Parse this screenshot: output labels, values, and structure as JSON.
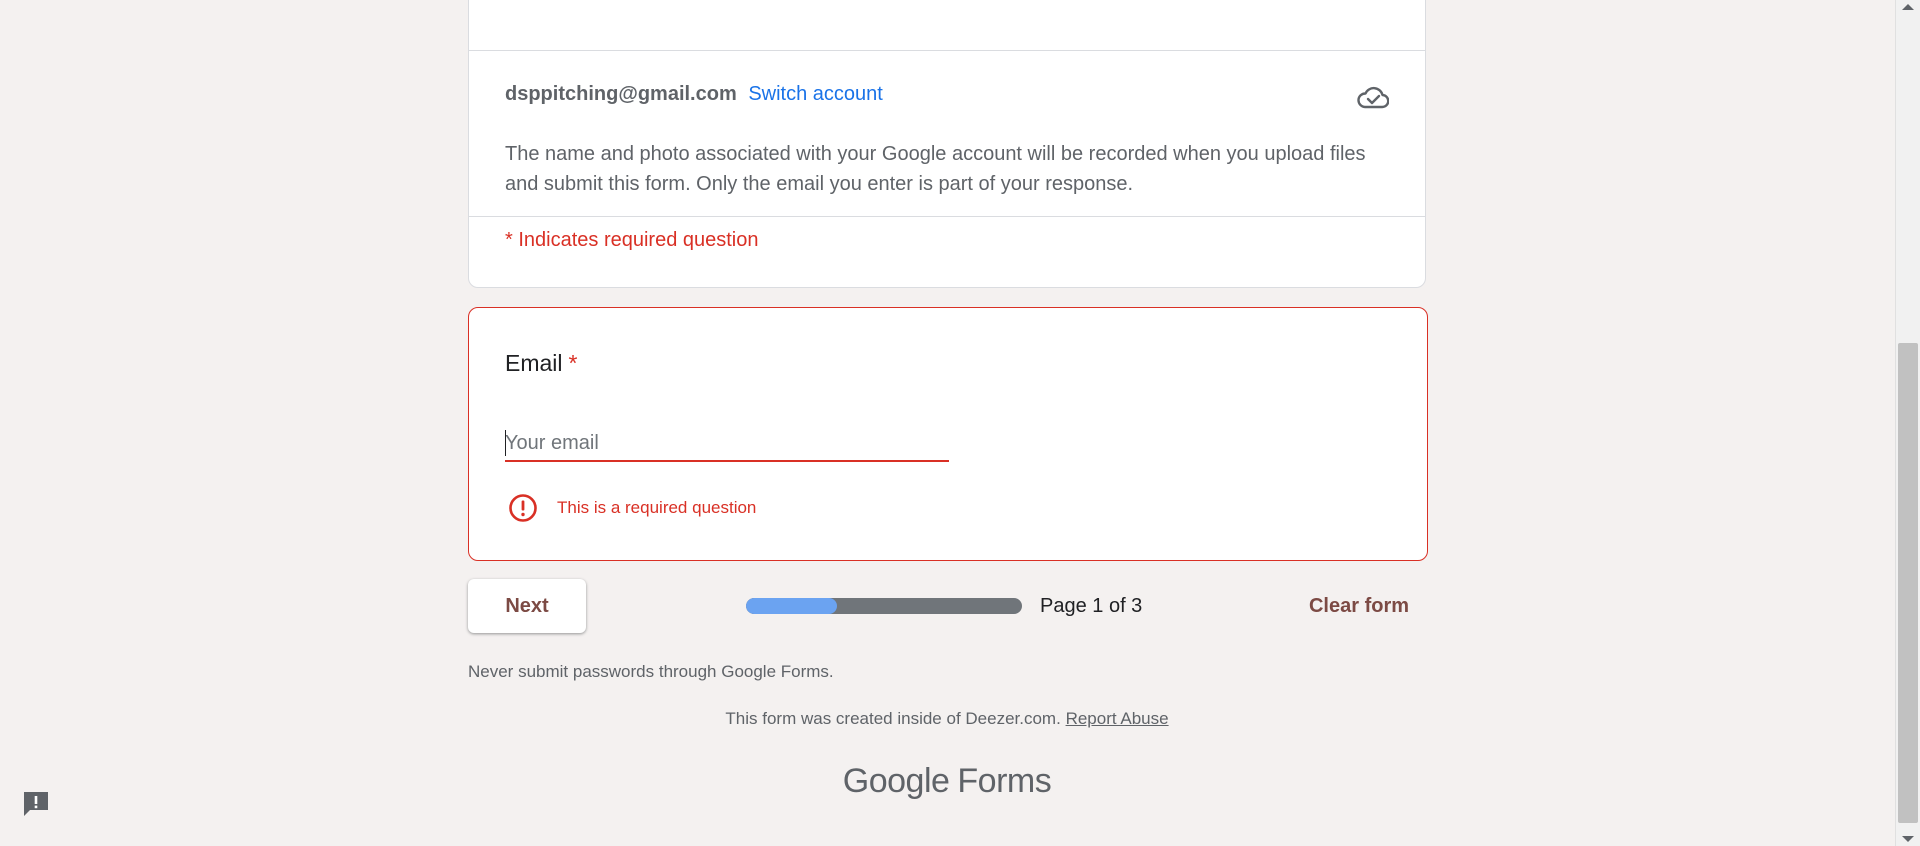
{
  "account": {
    "email": "dsppitching@gmail.com",
    "switch_label": "Switch account",
    "note": "The name and photo associated with your Google account will be recorded when you upload files and submit this form. Only the email you enter is part of your response.",
    "saved_icon": "cloud-check-icon"
  },
  "form": {
    "required_note": "* Indicates required question"
  },
  "question": {
    "title": "Email",
    "required_mark": "*",
    "placeholder": "Your email",
    "value": "",
    "error": "This is a required question",
    "error_icon": "error-icon"
  },
  "navigation": {
    "next_label": "Next",
    "progress": 0.33,
    "page_indicator": "Page 1 of 3",
    "clear_label": "Clear form"
  },
  "footer": {
    "password_warning": "Never submit passwords through Google Forms.",
    "created_text": "This form was created inside of Deezer.com.",
    "report_label": "Report Abuse",
    "logo_brand": "Google",
    "logo_product": "Forms"
  },
  "colors": {
    "error": "#d93025",
    "link": "#1a73e8",
    "accent": "#7c4a44",
    "progress_fill": "#6ba3f1",
    "progress_track": "#70757a"
  }
}
